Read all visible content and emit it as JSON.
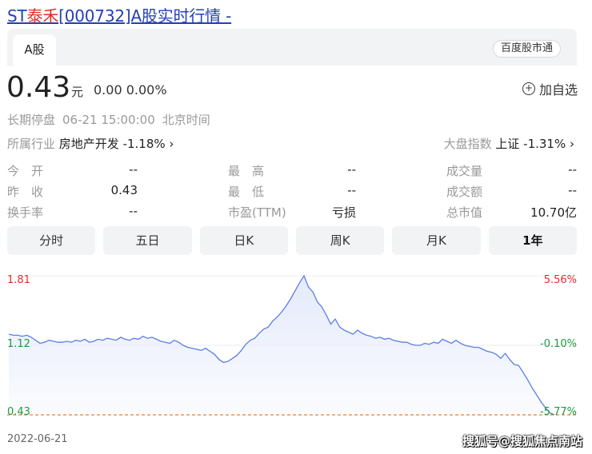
{
  "title": {
    "prefix": "ST",
    "name": "泰禾",
    "suffix": "[000732]A股实时行情 -"
  },
  "tabs": {
    "active": "A股",
    "badge": "百度股市通"
  },
  "quote": {
    "price": "0.43",
    "unit": "元",
    "change": "0.00 0.00%"
  },
  "watchlist": {
    "label": "加自选"
  },
  "status": {
    "state": "长期停盘",
    "time": "06-21 15:00:00",
    "zone": "北京时间"
  },
  "industry": {
    "label": "所属行业",
    "value": "房地产开发 -1.18% ›"
  },
  "market_index": {
    "label": "大盘指数",
    "value": "上证 -1.31% ›"
  },
  "stats": [
    {
      "label": "今　开",
      "value": "--"
    },
    {
      "label": "最　高",
      "value": "--"
    },
    {
      "label": "成交量",
      "value": "--"
    },
    {
      "label": "昨　收",
      "value": "0.43"
    },
    {
      "label": "最　低",
      "value": "--"
    },
    {
      "label": "成交额",
      "value": "--"
    },
    {
      "label": "换手率",
      "value": "--"
    },
    {
      "label": "市盈(TTM)",
      "value": "亏损"
    },
    {
      "label": "总市值",
      "value": "10.70亿"
    }
  ],
  "periods": [
    "分时",
    "五日",
    "日K",
    "周K",
    "月K",
    "1年"
  ],
  "active_period": "1年",
  "colors": {
    "line": "#5b7ee5",
    "fill": "#e3e9fb",
    "up": "#e12b2b",
    "down": "#1a9a3c",
    "base": "#f07d2a"
  },
  "chart_data": {
    "type": "area",
    "y_left": [
      "1.81",
      "1.12",
      "0.43"
    ],
    "y_right": [
      "5.56%",
      "-0.10%",
      "-5.77%"
    ],
    "ylim": [
      0.43,
      1.81
    ],
    "baseline": 0.43,
    "start_date": "2022-06-21",
    "values": [
      1.23,
      1.22,
      1.22,
      1.21,
      1.22,
      1.2,
      1.17,
      1.14,
      1.15,
      1.17,
      1.16,
      1.15,
      1.15,
      1.16,
      1.15,
      1.17,
      1.16,
      1.18,
      1.15,
      1.16,
      1.18,
      1.17,
      1.19,
      1.18,
      1.17,
      1.2,
      1.18,
      1.17,
      1.19,
      1.18,
      1.21,
      1.19,
      1.2,
      1.18,
      1.16,
      1.15,
      1.14,
      1.17,
      1.15,
      1.12,
      1.1,
      1.09,
      1.08,
      1.07,
      1.09,
      1.06,
      1.03,
      0.98,
      0.95,
      0.96,
      0.99,
      1.02,
      1.07,
      1.13,
      1.17,
      1.19,
      1.24,
      1.28,
      1.3,
      1.36,
      1.4,
      1.45,
      1.51,
      1.58,
      1.66,
      1.74,
      1.81,
      1.7,
      1.65,
      1.55,
      1.5,
      1.42,
      1.33,
      1.38,
      1.3,
      1.27,
      1.25,
      1.23,
      1.27,
      1.24,
      1.22,
      1.21,
      1.19,
      1.2,
      1.18,
      1.19,
      1.17,
      1.16,
      1.15,
      1.15,
      1.13,
      1.12,
      1.12,
      1.14,
      1.13,
      1.15,
      1.14,
      1.18,
      1.16,
      1.14,
      1.17,
      1.14,
      1.12,
      1.11,
      1.1,
      1.1,
      1.08,
      1.06,
      1.05,
      1.03,
      0.99,
      1.04,
      0.98,
      0.93,
      0.92,
      0.85,
      0.78,
      0.7,
      0.63,
      0.56,
      0.5,
      0.45
    ],
    "values_to_end": "0.43"
  },
  "watermark": "搜狐号@搜狐焦点南站"
}
